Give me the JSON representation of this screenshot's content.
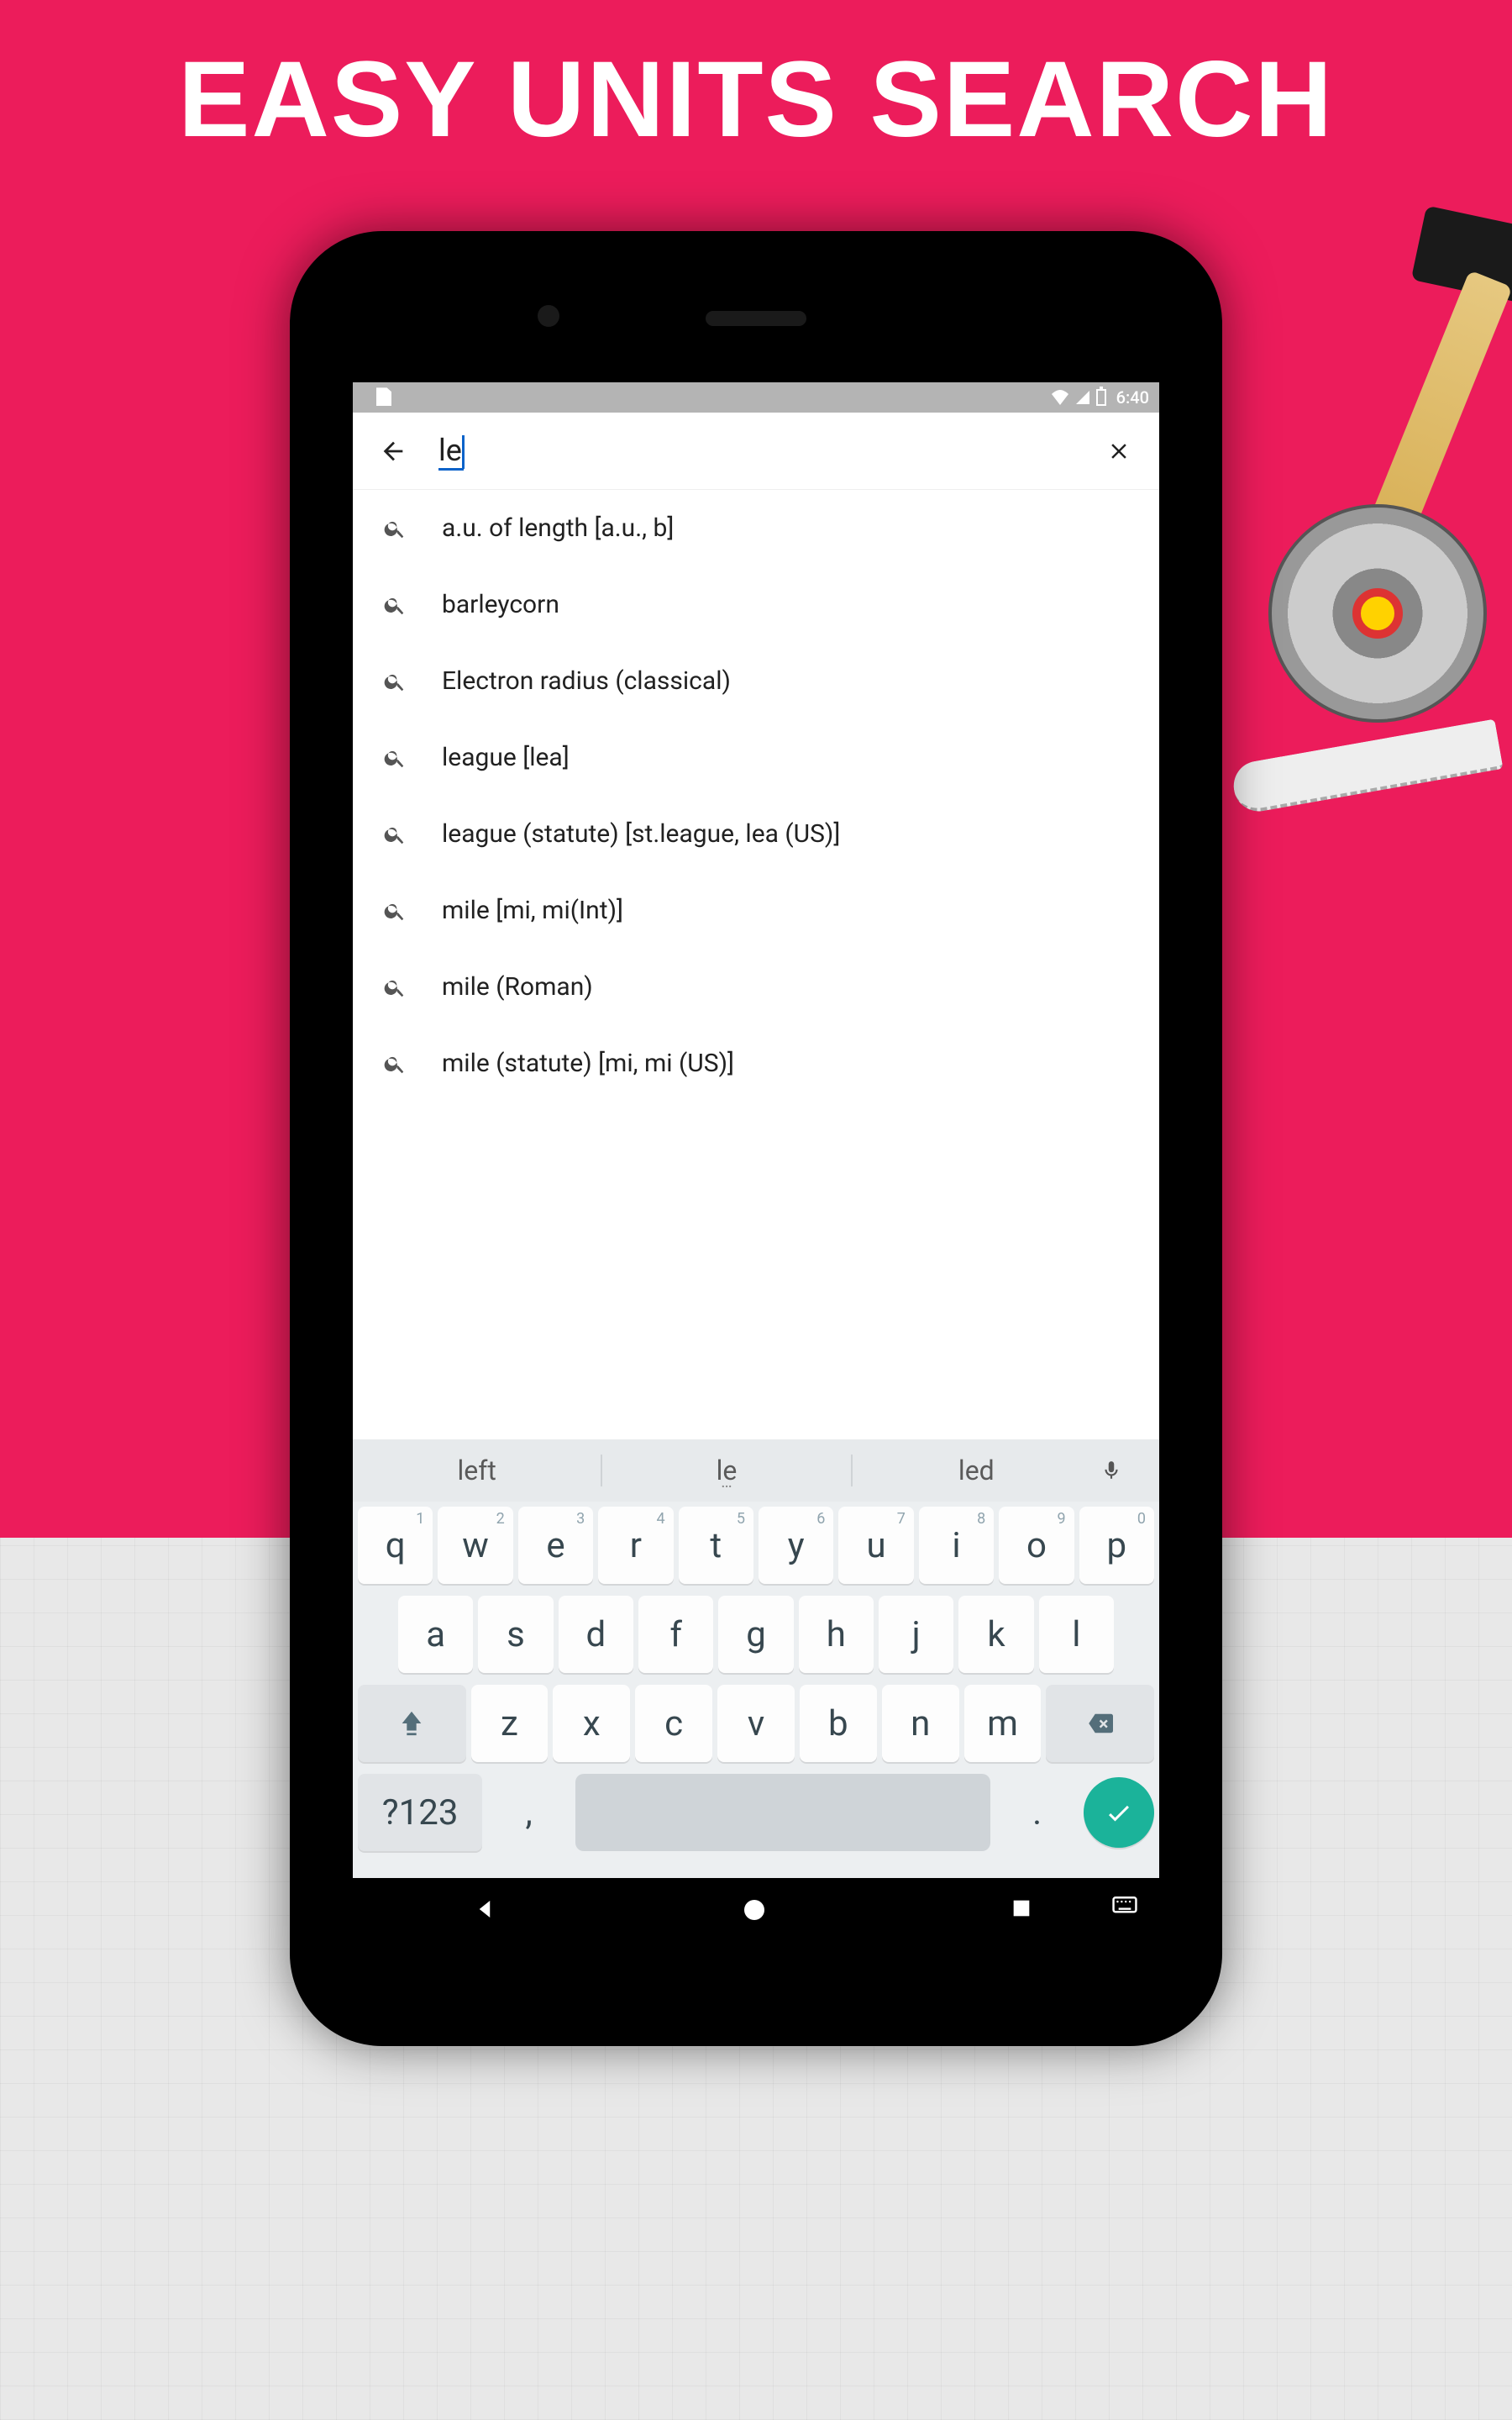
{
  "promo": {
    "title": "EASY UNITS SEARCH"
  },
  "status": {
    "time": "6:40"
  },
  "search": {
    "query": "le"
  },
  "results": [
    {
      "label": "a.u. of length [a.u., b]"
    },
    {
      "label": "barleycorn"
    },
    {
      "label": "Electron radius (classical)"
    },
    {
      "label": "league [lea]"
    },
    {
      "label": "league (statute) [st.league, lea (US)]"
    },
    {
      "label": "mile [mi, mi(Int)]"
    },
    {
      "label": "mile (Roman)"
    },
    {
      "label": "mile (statute) [mi, mi (US)]"
    }
  ],
  "suggestions": {
    "s1": "left",
    "s2": "le",
    "s3": "led"
  },
  "keyboard": {
    "row1": [
      {
        "k": "q",
        "n": "1"
      },
      {
        "k": "w",
        "n": "2"
      },
      {
        "k": "e",
        "n": "3"
      },
      {
        "k": "r",
        "n": "4"
      },
      {
        "k": "t",
        "n": "5"
      },
      {
        "k": "y",
        "n": "6"
      },
      {
        "k": "u",
        "n": "7"
      },
      {
        "k": "i",
        "n": "8"
      },
      {
        "k": "o",
        "n": "9"
      },
      {
        "k": "p",
        "n": "0"
      }
    ],
    "row2": [
      "a",
      "s",
      "d",
      "f",
      "g",
      "h",
      "j",
      "k",
      "l"
    ],
    "row3": [
      "z",
      "x",
      "c",
      "v",
      "b",
      "n",
      "m"
    ],
    "symkey": "?123",
    "comma": ",",
    "period": "."
  }
}
